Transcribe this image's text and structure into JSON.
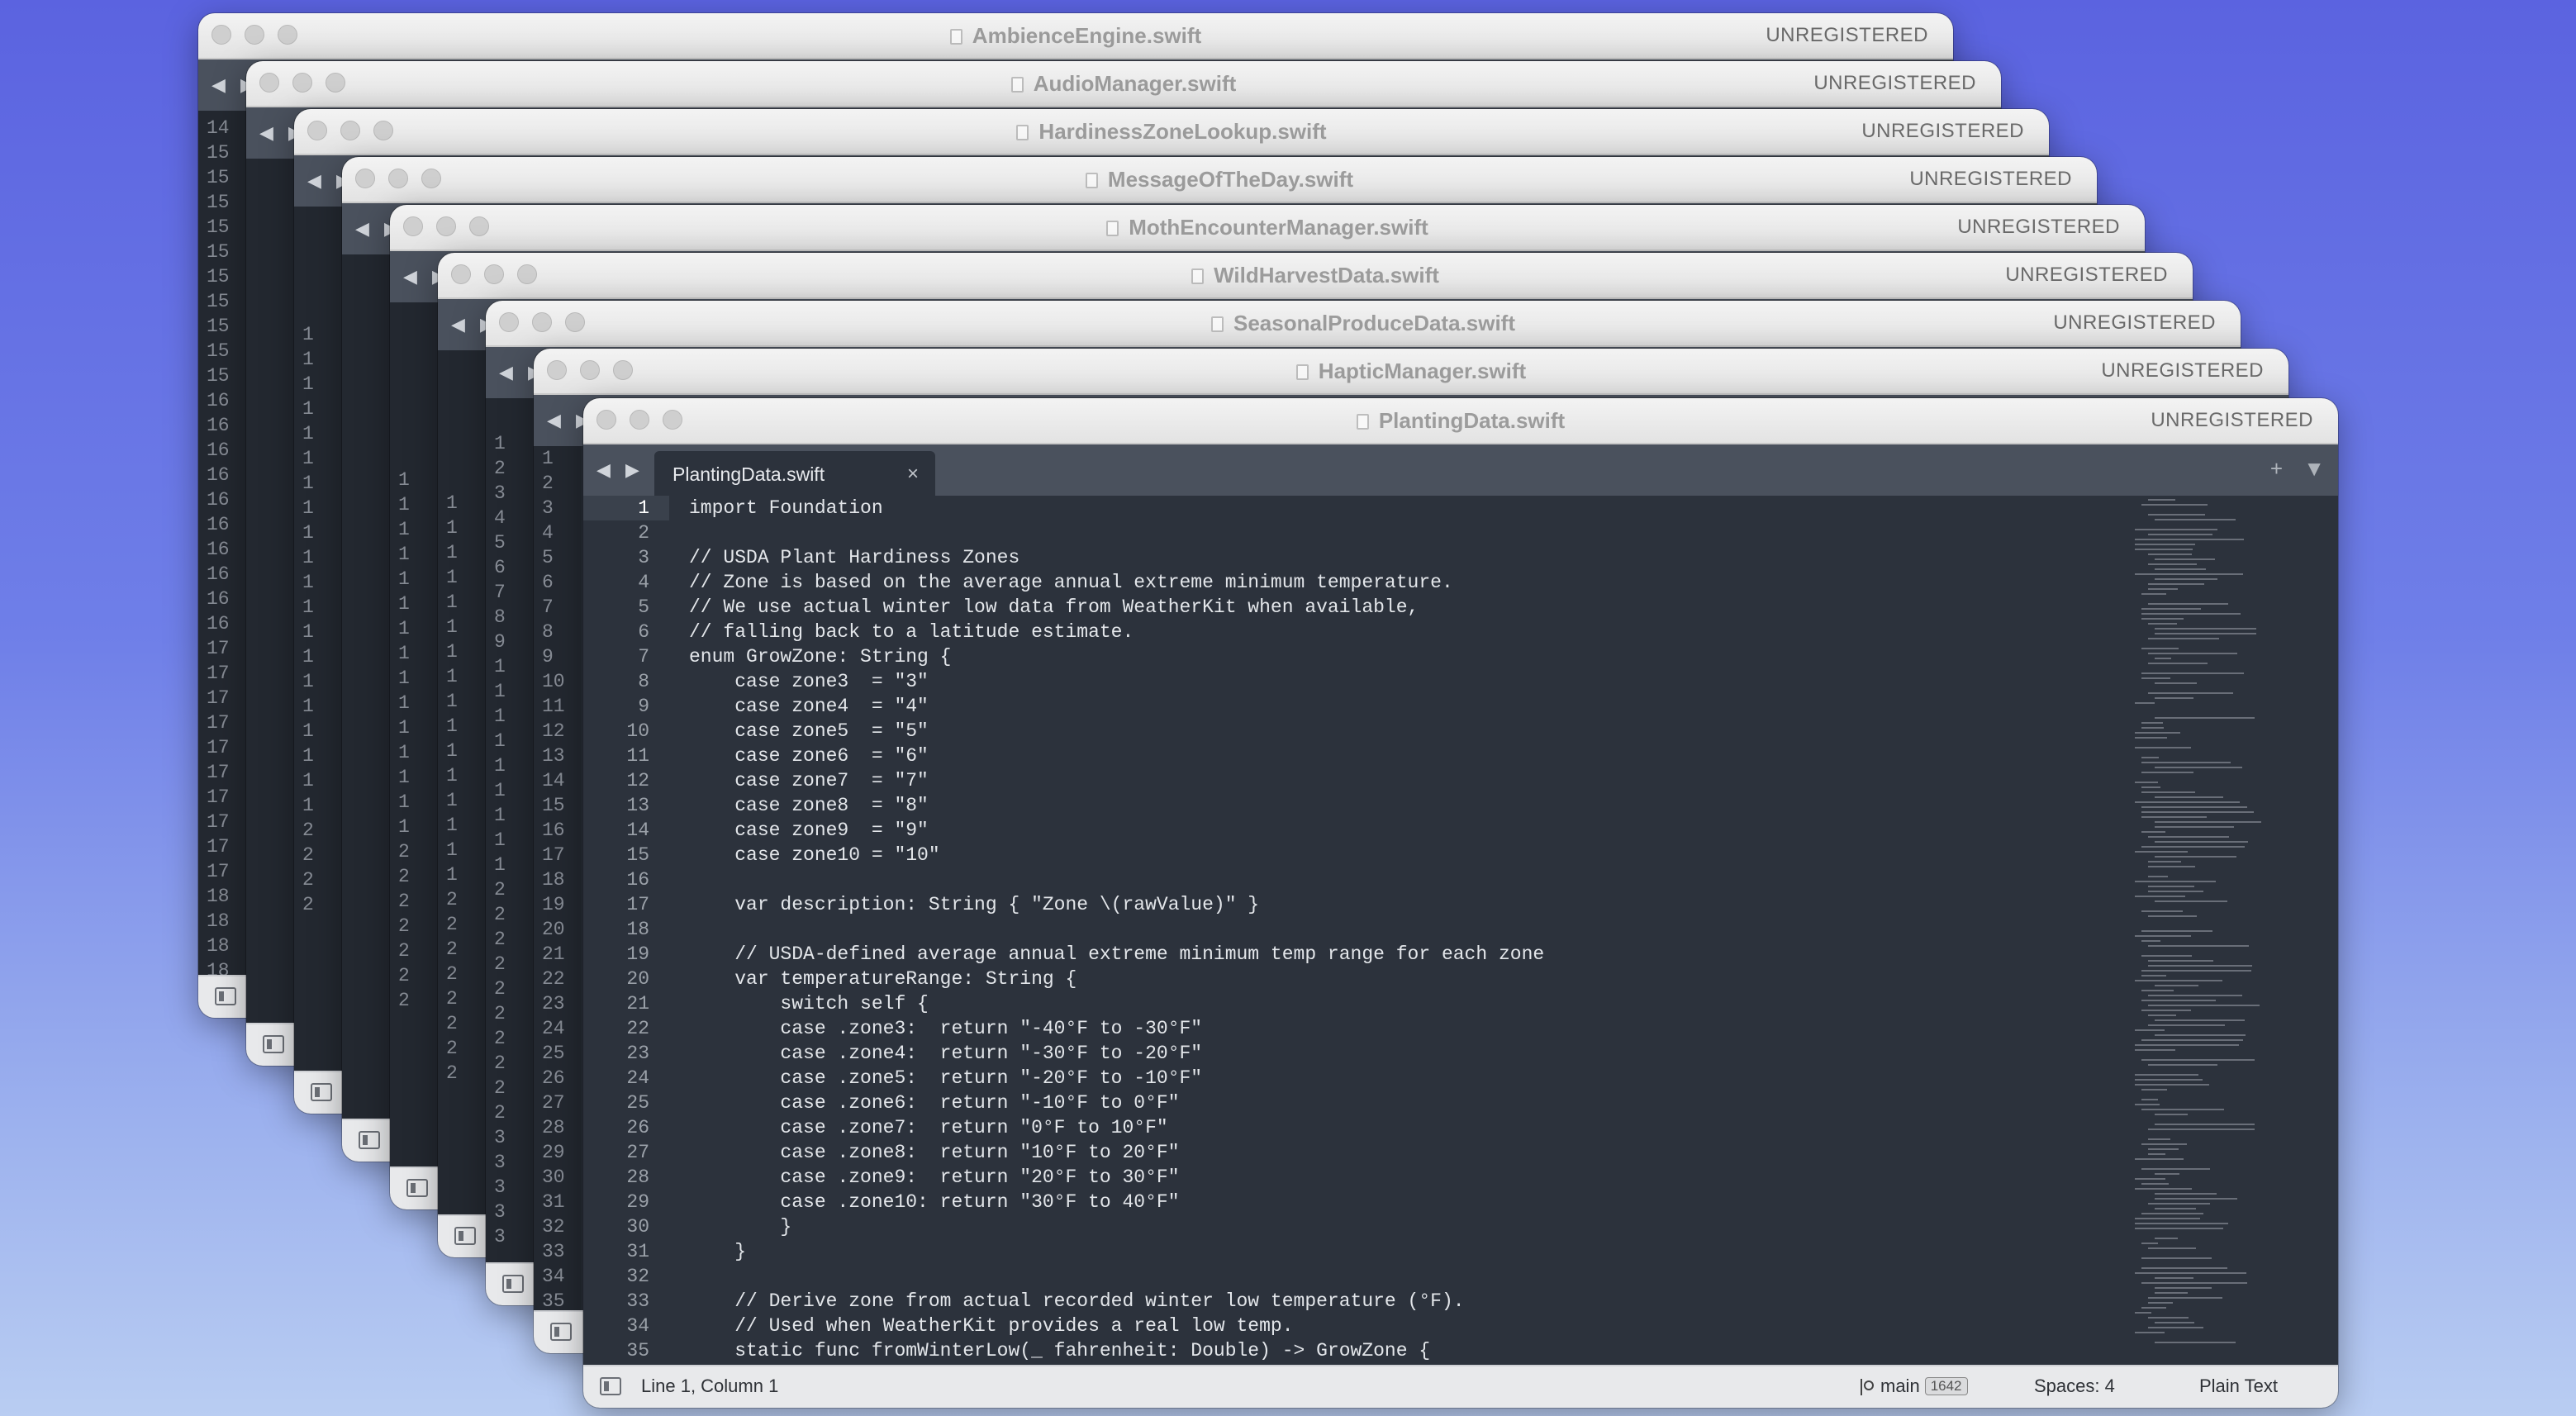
{
  "windows": [
    {
      "title": "AmbienceEngine.swift",
      "status": "UNREGISTERED",
      "visible_line_numbers": [
        "14",
        "15",
        "15",
        "15",
        "15",
        "15",
        "15",
        "15",
        "15",
        "15",
        "15",
        "16",
        "16",
        "16",
        "16",
        "16",
        "16",
        "16",
        "16",
        "16",
        "16",
        "17",
        "17",
        "17",
        "17",
        "17",
        "17",
        "17",
        "17",
        "17",
        "17",
        "18",
        "18",
        "18",
        "18"
      ]
    },
    {
      "title": "AudioManager.swift",
      "status": "UNREGISTERED",
      "visible_line_numbers": []
    },
    {
      "title": "HardinessZoneLookup.swift",
      "status": "UNREGISTERED",
      "visible_line_numbers": [
        "1",
        "1",
        "1",
        "1",
        "1",
        "1",
        "1",
        "1",
        "1",
        "1",
        "1",
        "1",
        "1",
        "1",
        "1",
        "1",
        "1",
        "1",
        "1",
        "1",
        "2",
        "2",
        "2",
        "2"
      ]
    },
    {
      "title": "MessageOfTheDay.swift",
      "status": "UNREGISTERED",
      "visible_line_numbers": []
    },
    {
      "title": "MothEncounterManager.swift",
      "status": "UNREGISTERED",
      "visible_line_numbers": [
        "1",
        "1",
        "1",
        "1",
        "1",
        "1",
        "1",
        "1",
        "1",
        "1",
        "1",
        "1",
        "1",
        "1",
        "1",
        "2",
        "2",
        "2",
        "2",
        "2",
        "2",
        "2"
      ]
    },
    {
      "title": "WildHarvestData.swift",
      "status": "UNREGISTERED",
      "visible_line_numbers": [
        "1",
        "1",
        "1",
        "1",
        "1",
        "1",
        "1",
        "1",
        "1",
        "1",
        "1",
        "1",
        "1",
        "1",
        "1",
        "1",
        "2",
        "2",
        "2",
        "2",
        "2",
        "2",
        "2",
        "2"
      ]
    },
    {
      "title": "SeasonalProduceData.swift",
      "status": "UNREGISTERED",
      "visible_line_numbers": [
        "1",
        "2",
        "3",
        "4",
        "5",
        "6",
        "7",
        "8",
        "9",
        "1",
        "1",
        "1",
        "1",
        "1",
        "1",
        "1",
        "1",
        "1",
        "2",
        "2",
        "2",
        "2",
        "2",
        "2",
        "2",
        "2",
        "2",
        "2",
        "3",
        "3",
        "3",
        "3",
        "3"
      ]
    },
    {
      "title": "HapticManager.swift",
      "status": "UNREGISTERED",
      "visible_line_numbers": [
        "1",
        "2",
        "3",
        "4",
        "5",
        "6",
        "7",
        "8",
        "9",
        "10",
        "11",
        "12",
        "13",
        "14",
        "15",
        "16",
        "17",
        "18",
        "19",
        "20",
        "21",
        "22",
        "23",
        "24",
        "25",
        "26",
        "27",
        "28",
        "29",
        "30",
        "31",
        "32",
        "33",
        "34",
        "35"
      ]
    }
  ],
  "front": {
    "title": "PlantingData.swift",
    "status": "UNREGISTERED",
    "tab_label": "PlantingData.swift",
    "tab_close": "×",
    "nav_arrows": "◀ ▶",
    "tab_add": "+",
    "tab_menu": "▼",
    "current_line": 1,
    "line_numbers": [
      "1",
      "2",
      "3",
      "4",
      "5",
      "6",
      "7",
      "8",
      "9",
      "10",
      "11",
      "12",
      "13",
      "14",
      "15",
      "16",
      "17",
      "18",
      "19",
      "20",
      "21",
      "22",
      "23",
      "24",
      "25",
      "26",
      "27",
      "28",
      "29",
      "30",
      "31",
      "32",
      "33",
      "34",
      "35"
    ],
    "code": [
      "import Foundation",
      "",
      "// USDA Plant Hardiness Zones",
      "// Zone is based on the average annual extreme minimum temperature.",
      "// We use actual winter low data from WeatherKit when available,",
      "// falling back to a latitude estimate.",
      "enum GrowZone: String {",
      "    case zone3  = \"3\"",
      "    case zone4  = \"4\"",
      "    case zone5  = \"5\"",
      "    case zone6  = \"6\"",
      "    case zone7  = \"7\"",
      "    case zone8  = \"8\"",
      "    case zone9  = \"9\"",
      "    case zone10 = \"10\"",
      "",
      "    var description: String { \"Zone \\(rawValue)\" }",
      "",
      "    // USDA-defined average annual extreme minimum temp range for each zone",
      "    var temperatureRange: String {",
      "        switch self {",
      "        case .zone3:  return \"-40°F to -30°F\"",
      "        case .zone4:  return \"-30°F to -20°F\"",
      "        case .zone5:  return \"-20°F to -10°F\"",
      "        case .zone6:  return \"-10°F to 0°F\"",
      "        case .zone7:  return \"0°F to 10°F\"",
      "        case .zone8:  return \"10°F to 20°F\"",
      "        case .zone9:  return \"20°F to 30°F\"",
      "        case .zone10: return \"30°F to 40°F\"",
      "        }",
      "    }",
      "",
      "    // Derive zone from actual recorded winter low temperature (°F).",
      "    // Used when WeatherKit provides a real low temp.",
      "    static func fromWinterLow(_ fahrenheit: Double) -> GrowZone {"
    ],
    "statusbar": {
      "position": "Line 1, Column 1",
      "branch": "main",
      "branch_count": "1642",
      "indent": "Spaces: 4",
      "syntax": "Plain Text"
    }
  },
  "icons": [
    "traffic-light-icon",
    "file-icon",
    "sidebar-toggle-icon",
    "branch-icon",
    "close-icon",
    "plus-icon",
    "chevron-down-icon"
  ]
}
